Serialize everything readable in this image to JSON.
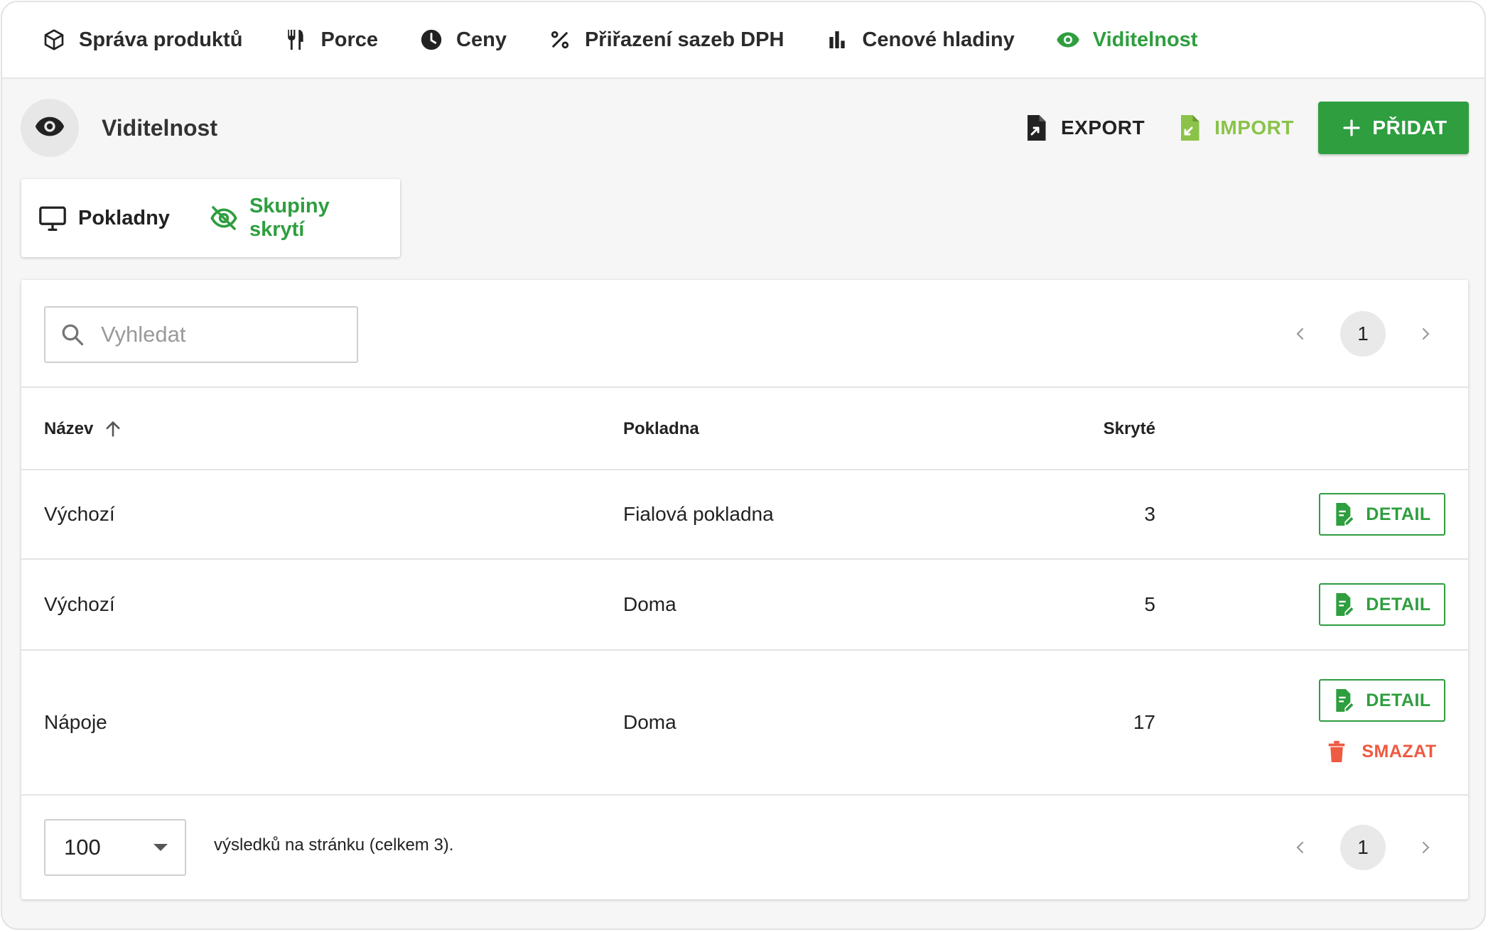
{
  "topnav": {
    "items": [
      {
        "label": "Správa produktů",
        "icon": "box-icon",
        "active": false
      },
      {
        "label": "Porce",
        "icon": "fork-knife-icon",
        "active": false
      },
      {
        "label": "Ceny",
        "icon": "clock-icon",
        "active": false
      },
      {
        "label": "Přiřazení sazeb DPH",
        "icon": "percent-icon",
        "active": false
      },
      {
        "label": "Cenové hladiny",
        "icon": "bar-chart-icon",
        "active": false
      },
      {
        "label": "Viditelnost",
        "icon": "eye-icon",
        "active": true
      }
    ]
  },
  "header": {
    "title": "Viditelnost",
    "export_label": "EXPORT",
    "import_label": "IMPORT",
    "add_label": "PŘIDAT"
  },
  "subtabs": [
    {
      "label": "Pokladny",
      "icon": "monitor-icon",
      "active": false
    },
    {
      "label": "Skupiny skrytí",
      "icon": "eye-off-icon",
      "active": true
    }
  ],
  "search": {
    "placeholder": "Vyhledat",
    "value": ""
  },
  "pagination": {
    "current_page": "1"
  },
  "table": {
    "columns": {
      "name": "Název",
      "pos": "Pokladna",
      "hidden": "Skryté"
    },
    "rows": [
      {
        "name": "Výchozí",
        "pos": "Fialová pokladna",
        "hidden": "3",
        "detail_label": "DETAIL"
      },
      {
        "name": "Výchozí",
        "pos": "Doma",
        "hidden": "5",
        "detail_label": "DETAIL"
      },
      {
        "name": "Nápoje",
        "pos": "Doma",
        "hidden": "17",
        "detail_label": "DETAIL",
        "delete_label": "SMAZAT"
      }
    ]
  },
  "footer": {
    "per_page": "100",
    "summary": "výsledků na stránku (celkem 3)."
  },
  "colors": {
    "accent": "#2e9e3f",
    "import": "#8bc34a",
    "danger": "#ef5a42"
  }
}
